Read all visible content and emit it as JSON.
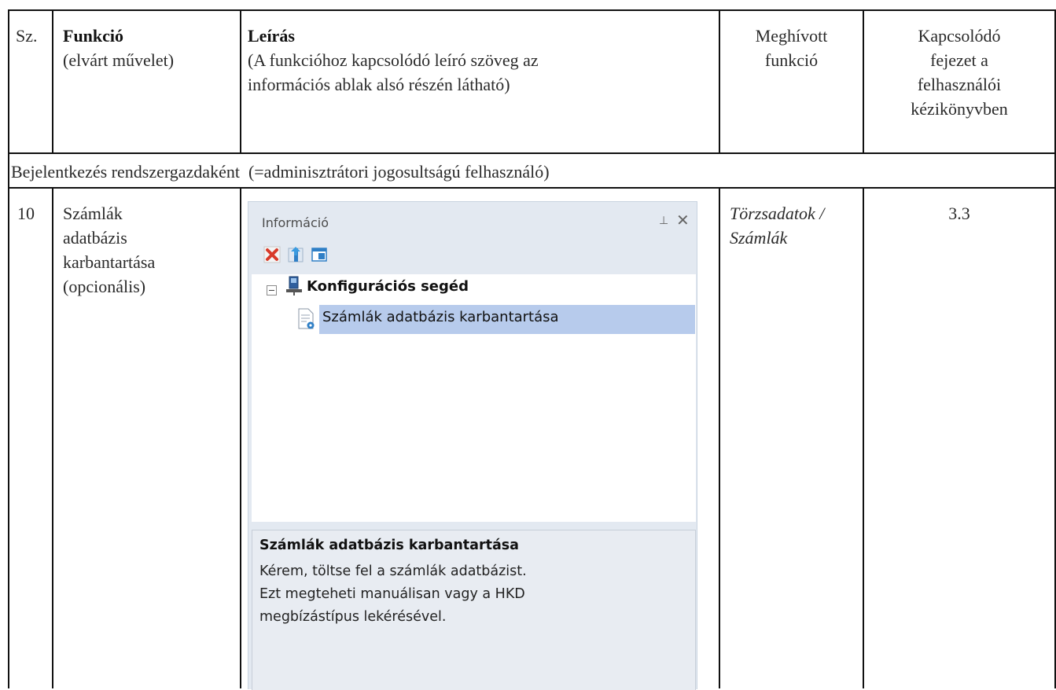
{
  "header": {
    "sz": "Sz.",
    "funkcio_title": "Funkció",
    "funkcio_sub": "(elvárt művelet)",
    "leiras_title": "Leírás",
    "leiras_sub_1": "(A funkcióhoz kapcsolódó leíró szöveg az",
    "leiras_sub_2": "információs ablak alsó részén látható)",
    "meghivott_1": "Meghívott",
    "meghivott_2": "funkció",
    "kapcs_1": "Kapcsolódó",
    "kapcs_2": "fejezet a",
    "kapcs_3": "felhasználói",
    "kapcs_4": "kézikönyvben"
  },
  "section_row": "Bejelentkezés rendszergazdaként  (=adminisztrátori jogosultságú felhasználó)",
  "row": {
    "number": "10",
    "function_lines": [
      "Számlák",
      "adatbázis",
      "karbantartása",
      "(opcionális)"
    ],
    "called_function_1": "Törzsadatok /",
    "called_function_2": "Számlák",
    "chapter": "3.3"
  },
  "panel": {
    "title": "Információ",
    "pin_glyph": "⊥",
    "close_glyph": "✕",
    "tree_root": "Konfigurációs segéd",
    "tree_child": "Számlák adatbázis karbantartása",
    "desc_title": "Számlák adatbázis karbantartása",
    "desc_body": "Kérem, töltse fel a számlák adatbázist.\nEzt megteheti manuálisan vagy a HKD\nmegbízástípus lekérésével."
  },
  "colors": {
    "selection": "#b7cbec",
    "panel_bg": "#e3e9f1",
    "delete_red": "#d83a2a",
    "toolbar_blue": "#2f7fc6"
  }
}
